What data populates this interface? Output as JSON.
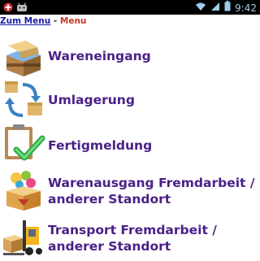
{
  "status_bar": {
    "time": "9:42",
    "icons": [
      "notification-icon",
      "android-debug-icon",
      "wifi-icon",
      "signal-icon",
      "battery-icon"
    ]
  },
  "breadcrumb": {
    "link_label": "Zum Menu",
    "separator": "-",
    "current": "Menu"
  },
  "menu": {
    "items": [
      {
        "label": "Wareneingang",
        "icon": "goods-receipt-icon"
      },
      {
        "label": "Umlagerung",
        "icon": "relocation-icon"
      },
      {
        "label": "Fertigmeldung",
        "icon": "completion-report-icon"
      },
      {
        "label": "Warenausgang Fremdarbeit / anderer Standort",
        "icon": "goods-issue-icon"
      },
      {
        "label": "Transport Fremdarbeit / anderer Standort",
        "icon": "forklift-transport-icon"
      }
    ]
  },
  "colors": {
    "label": "#4b2088",
    "link": "#1a1aa6",
    "current": "#c0392b"
  }
}
